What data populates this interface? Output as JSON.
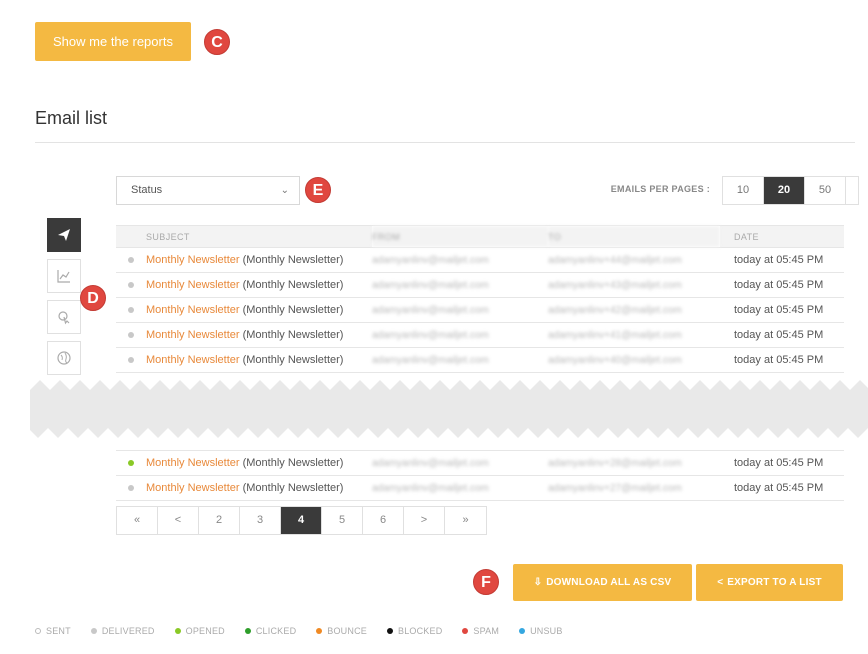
{
  "reports_button": "Show me the reports",
  "markers": {
    "c": "C",
    "d": "D",
    "e": "E",
    "f": "F"
  },
  "title": "Email list",
  "status_filter": {
    "value": "Status",
    "chevron": "⌄"
  },
  "per_page": {
    "label": "EMAILS PER PAGES :",
    "options": [
      "10",
      "20",
      "50"
    ],
    "selected": "20"
  },
  "sidebar_tabs": [
    "send-icon",
    "chart-icon",
    "click-icon",
    "globe-icon"
  ],
  "table": {
    "headers": [
      "SUBJECT",
      "FROM",
      "TO",
      "DATE"
    ],
    "rows": [
      {
        "status": "delivered",
        "subject": "Monthly Newsletter",
        "campaign": "(Monthly Newsletter)",
        "from": "adamyanlinv@mailjet.com",
        "to": "adamyanlinv+44@mailjet.com",
        "date": "today at 05:45 PM"
      },
      {
        "status": "delivered",
        "subject": "Monthly Newsletter",
        "campaign": "(Monthly Newsletter)",
        "from": "adamyanlinv@mailjet.com",
        "to": "adamyanlinv+43@mailjet.com",
        "date": "today at 05:45 PM"
      },
      {
        "status": "delivered",
        "subject": "Monthly Newsletter",
        "campaign": "(Monthly Newsletter)",
        "from": "adamyanlinv@mailjet.com",
        "to": "adamyanlinv+42@mailjet.com",
        "date": "today at 05:45 PM"
      },
      {
        "status": "delivered",
        "subject": "Monthly Newsletter",
        "campaign": "(Monthly Newsletter)",
        "from": "adamyanlinv@mailjet.com",
        "to": "adamyanlinv+41@mailjet.com",
        "date": "today at 05:45 PM"
      },
      {
        "status": "delivered",
        "subject": "Monthly Newsletter",
        "campaign": "(Monthly Newsletter)",
        "from": "adamyanlinv@mailjet.com",
        "to": "adamyanlinv+40@mailjet.com",
        "date": "today at 05:45 PM"
      }
    ],
    "bottom_rows": [
      {
        "status": "opened",
        "subject": "Monthly Newsletter",
        "campaign": "(Monthly Newsletter)",
        "from": "adamyanlinv@mailjet.com",
        "to": "adamyanlinv+28@mailjet.com",
        "date": "today at 05:45 PM"
      },
      {
        "status": "delivered",
        "subject": "Monthly Newsletter",
        "campaign": "(Monthly Newsletter)",
        "from": "adamyanlinv@mailjet.com",
        "to": "adamyanlinv+27@mailjet.com",
        "date": "today at 05:45 PM"
      }
    ]
  },
  "pagination": {
    "items": [
      "«",
      "<",
      "2",
      "3",
      "4",
      "5",
      "6",
      ">",
      "»"
    ],
    "current": "4"
  },
  "download_button": "DOWNLOAD ALL AS CSV",
  "export_button": "EXPORT TO A LIST",
  "legend": [
    {
      "label": "SENT",
      "color": "#ffffff"
    },
    {
      "label": "DELIVERED",
      "color": "#c8c8c8"
    },
    {
      "label": "OPENED",
      "color": "#8ac926"
    },
    {
      "label": "CLICKED",
      "color": "#2e9e2a"
    },
    {
      "label": "BOUNCE",
      "color": "#f08a24"
    },
    {
      "label": "BLOCKED",
      "color": "#111111"
    },
    {
      "label": "SPAM",
      "color": "#e0473f"
    },
    {
      "label": "UNSUB",
      "color": "#35a7e0"
    }
  ],
  "colors": {
    "accent": "#f4b942",
    "link": "#e8893a",
    "marker": "#e0473f",
    "active": "#3a3a3a"
  }
}
